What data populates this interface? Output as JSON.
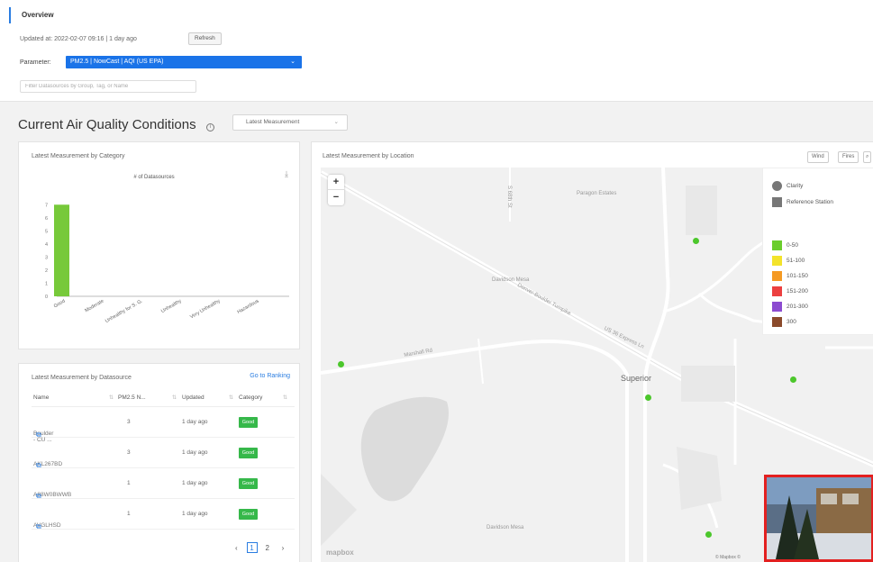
{
  "header": {
    "tab": "Overview",
    "updated": "Updated at: 2022-02-07 09:16 | 1 day ago",
    "refresh_label": "Refresh",
    "parameter_label": "Parameter:",
    "parameter_value": "PM2.5 | NowCast | AQI (US EPA)",
    "filter_placeholder": "Filter Datasources by Group, Tag, or Name"
  },
  "section": {
    "title": "Current Air Quality Conditions",
    "measurement_select": "Latest Measurement"
  },
  "category_panel": {
    "title": "Latest Measurement by Category",
    "legend": "# of Datasources"
  },
  "chart_data": {
    "type": "bar",
    "categories": [
      "Good",
      "Moderate",
      "Unhealthy for S. G.",
      "Unhealthy",
      "Very Unhealthy",
      "Hazardous"
    ],
    "values": [
      7,
      0,
      0,
      0,
      0,
      0
    ],
    "series_name": "# of Datasources",
    "yticks": [
      "0",
      "1",
      "2",
      "3",
      "4",
      "5",
      "6",
      "7"
    ],
    "ylim": [
      0,
      7.5
    ],
    "bar_color": "#77c93a"
  },
  "datasource_panel": {
    "title": "Latest Measurement by Datasource",
    "goto_label": "Go to Ranking",
    "columns": [
      "Name",
      "PM2.5 N...",
      "Updated",
      "Category"
    ],
    "rows": [
      {
        "name": "Boulder - CU ...",
        "value": "3",
        "updated": "1 day ago",
        "category": "Good"
      },
      {
        "name": "AKL267BD",
        "value": "3",
        "updated": "1 day ago",
        "category": "Good"
      },
      {
        "name": "A88W0BWWB",
        "value": "1",
        "updated": "1 day ago",
        "category": "Good"
      },
      {
        "name": "AVGLHSD",
        "value": "1",
        "updated": "1 day ago",
        "category": "Good"
      }
    ],
    "pages": [
      "1",
      "2"
    ],
    "prev": "‹",
    "next": "›"
  },
  "map_panel": {
    "title": "Latest Measurement by Location",
    "btn_wind": "Wind",
    "btn_fires": "Fires",
    "zoom_in": "+",
    "zoom_out": "−",
    "legend_types": [
      "Clarity",
      "Reference Station"
    ],
    "legend_ranges": [
      {
        "label": "0-50",
        "color": "#6acd2c"
      },
      {
        "label": "51-100",
        "color": "#f3e32b"
      },
      {
        "label": "101-150",
        "color": "#f59a23"
      },
      {
        "label": "151-200",
        "color": "#ec4040"
      },
      {
        "label": "201-300",
        "color": "#8c4bd0"
      },
      {
        "label": "300",
        "color": "#8b4a2b"
      }
    ],
    "places": [
      "Paragon Estates",
      "Davidson Mesa",
      "Superior",
      "Davidson Mesa",
      "Denver-Boulder Turnpike",
      "US 36 Express Ln",
      "Marshall Rd",
      "S 68th St"
    ],
    "mapbox": "mapbox",
    "credit": "© Mapbox ©"
  }
}
